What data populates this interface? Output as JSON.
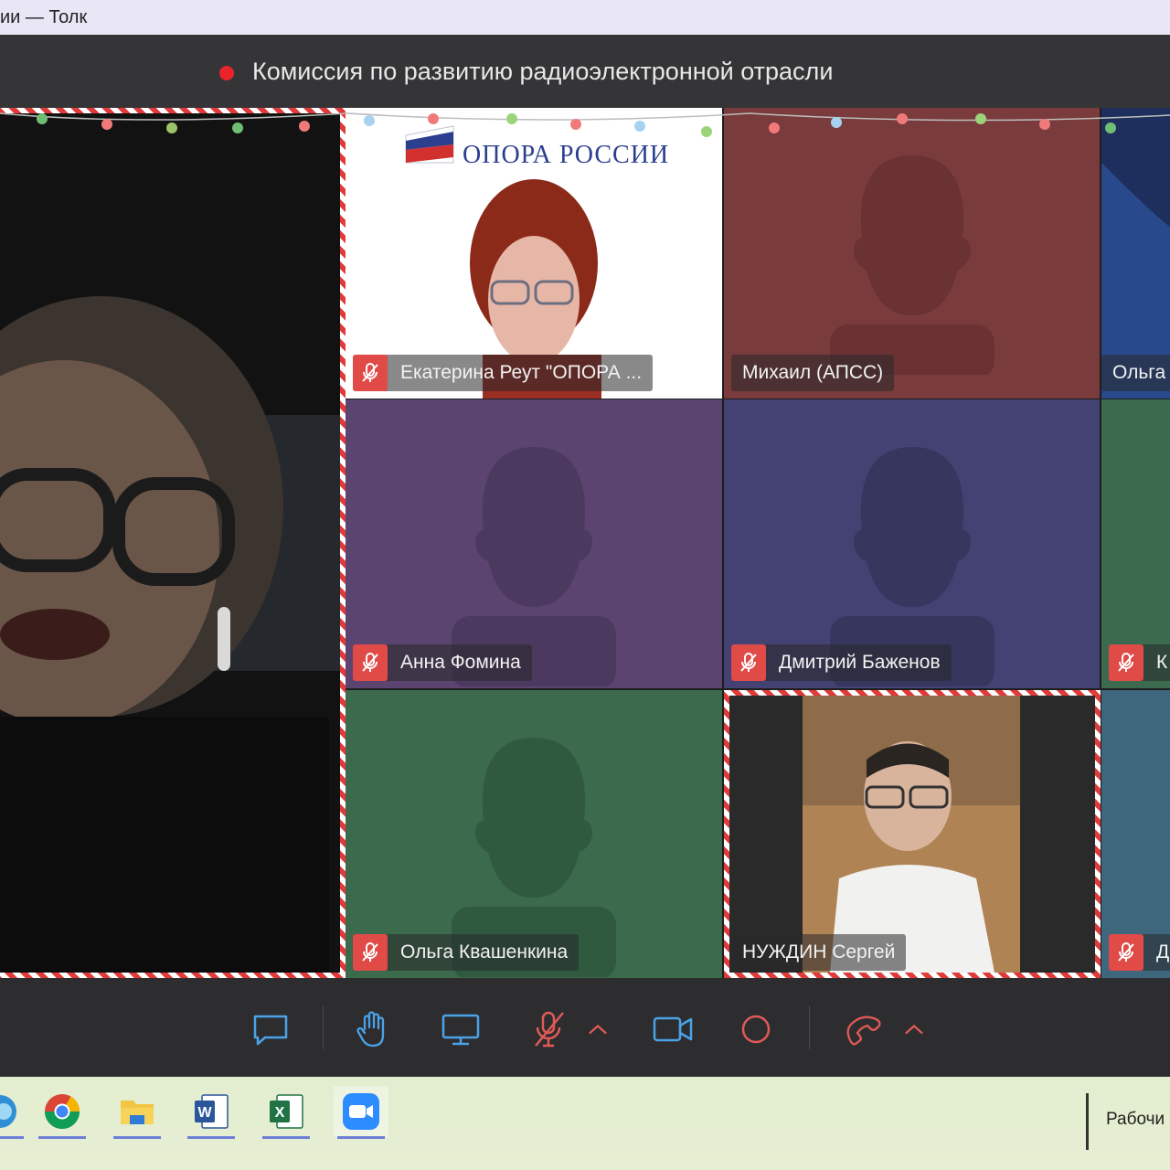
{
  "window": {
    "title": "ии — Толк"
  },
  "meeting": {
    "title": "Комиссия по развитию радиоэлектронной отрасли",
    "recording_color": "#e8232a"
  },
  "participants": [
    {
      "name": "Екатерина Реут \"ОПОРА ...",
      "muted": true,
      "bg": "#ffffff",
      "logo_text": "ОПОРА РОССИИ"
    },
    {
      "name": "Михаил (АПСС)",
      "muted": false,
      "bg": "#7a3b3c"
    },
    {
      "name": "Ольга",
      "muted": false,
      "bg": "#1e2f5e"
    },
    {
      "name": "Анна Фомина",
      "muted": true,
      "bg": "#5b4570"
    },
    {
      "name": "Дмитрий Баженов",
      "muted": true,
      "bg": "#434272"
    },
    {
      "name": "К",
      "muted": true,
      "bg": "#3b6a4e"
    },
    {
      "name": "Ольга Квашенкина",
      "muted": true,
      "bg": "#3c6a4d"
    },
    {
      "name": "НУЖДИН Сергей",
      "muted": false,
      "bg": "#2a2a2a"
    },
    {
      "name": "Д",
      "muted": true,
      "bg": "#3e667c"
    }
  ],
  "toolbar": {
    "items": [
      "chat-icon",
      "raise-hand-icon",
      "screen-share-icon",
      "microphone-off-icon",
      "chevron-up-icon",
      "camera-icon",
      "record-icon",
      "hang-up-icon",
      "chevron-up-icon"
    ],
    "hangup_color": "#e05a57"
  },
  "taskbar": {
    "apps": [
      "edge-icon",
      "chrome-icon",
      "file-explorer-icon",
      "word-icon",
      "excel-icon",
      "zoom-icon"
    ],
    "desktop_label": "Рабочи"
  }
}
